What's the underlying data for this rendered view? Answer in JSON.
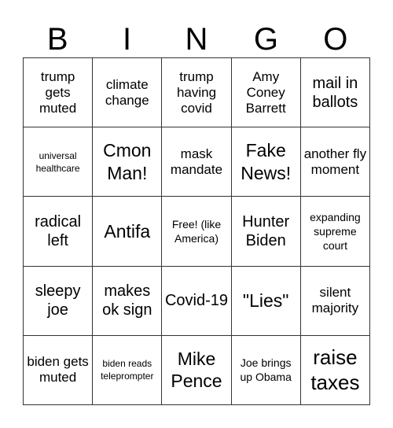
{
  "title_letters": [
    "B",
    "I",
    "N",
    "G",
    "O"
  ],
  "cells": [
    [
      "trump gets muted",
      "climate change",
      "trump having covid",
      "Amy Coney Barrett",
      "mail in ballots"
    ],
    [
      "universal healthcare",
      "Cmon Man!",
      "mask mandate",
      "Fake News!",
      "another fly moment"
    ],
    [
      "radical left",
      "Antifa",
      "Free! (like America)",
      "Hunter Biden",
      "expanding supreme court"
    ],
    [
      "sleepy joe",
      "makes ok sign",
      "Covid-19",
      "\"Lies\"",
      "silent majority"
    ],
    [
      "biden gets muted",
      "biden reads teleprompter",
      "Mike Pence",
      "Joe brings up Obama",
      "raise taxes"
    ]
  ]
}
